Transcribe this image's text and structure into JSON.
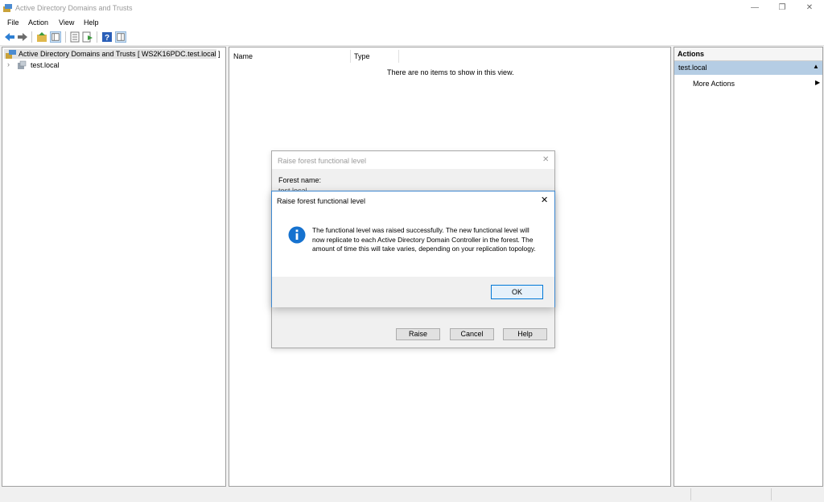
{
  "window": {
    "title": "Active Directory Domains and Trusts"
  },
  "menu": {
    "file": "File",
    "action": "Action",
    "view": "View",
    "help": "Help"
  },
  "tree": {
    "root_label": "Active Directory Domains and Trusts [ WS2K16PDC.test.local ]",
    "child_label": "test.local"
  },
  "list": {
    "col_name": "Name",
    "col_type": "Type",
    "empty_message": "There are no items to show in this view."
  },
  "actions": {
    "header": "Actions",
    "section": "test.local",
    "more_actions": "More Actions"
  },
  "outer_dialog": {
    "title": "Raise forest functional level",
    "forest_name_label": "Forest name:",
    "forest_name_value": "test.local",
    "raise_button": "Raise",
    "cancel_button": "Cancel",
    "help_button": "Help"
  },
  "message_box": {
    "title": "Raise forest functional level",
    "message": "The functional level was raised successfully. The new functional level will now replicate to each Active Directory Domain Controller in the forest. The amount of time this will take varies, depending on your replication topology.",
    "ok_button": "OK"
  },
  "colors": {
    "accent": "#0078d7",
    "selection": "#b5cde4",
    "info_icon": "#1672cf"
  }
}
